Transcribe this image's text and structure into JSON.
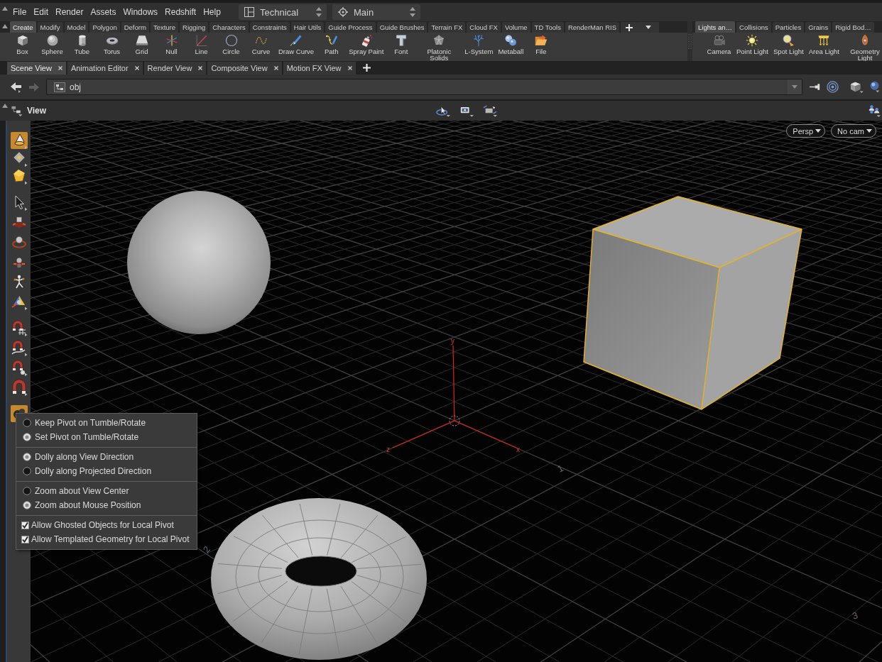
{
  "menu_bar": {
    "items": [
      "File",
      "Edit",
      "Render",
      "Assets",
      "Windows",
      "Redshift",
      "Help"
    ],
    "desktop": "Technical",
    "context": "Main"
  },
  "shelf": {
    "tabs": [
      {
        "label": "Create",
        "selected": true
      },
      {
        "label": "Modify",
        "selected": false
      },
      {
        "label": "Model",
        "selected": false
      },
      {
        "label": "Polygon",
        "selected": false
      },
      {
        "label": "Deform",
        "selected": false
      },
      {
        "label": "Texture",
        "selected": false
      },
      {
        "label": "Rigging",
        "selected": false
      },
      {
        "label": "Characters",
        "selected": false
      },
      {
        "label": "Constraints",
        "selected": false
      },
      {
        "label": "Hair Utils",
        "selected": false
      },
      {
        "label": "Guide Process",
        "selected": false
      },
      {
        "label": "Guide Brushes",
        "selected": false
      },
      {
        "label": "Terrain FX",
        "selected": false
      },
      {
        "label": "Cloud FX",
        "selected": false
      },
      {
        "label": "Volume",
        "selected": false
      },
      {
        "label": "TD Tools",
        "selected": false
      },
      {
        "label": "RenderMan RIS",
        "selected": false
      }
    ],
    "tools": [
      {
        "kind": "box",
        "label": "Box"
      },
      {
        "kind": "sphere",
        "label": "Sphere"
      },
      {
        "kind": "tube",
        "label": "Tube"
      },
      {
        "kind": "torus",
        "label": "Torus"
      },
      {
        "kind": "grid",
        "label": "Grid"
      },
      {
        "kind": "null",
        "label": "Null"
      },
      {
        "kind": "line",
        "label": "Line"
      },
      {
        "kind": "circle",
        "label": "Circle"
      },
      {
        "kind": "curve",
        "label": "Curve"
      },
      {
        "kind": "drawcurve",
        "label": "Draw Curve"
      },
      {
        "kind": "path",
        "label": "Path"
      },
      {
        "kind": "spraypaint",
        "label": "Spray Paint"
      },
      {
        "kind": "font",
        "label": "Font"
      },
      {
        "kind": "platonic",
        "label": "Platonic Solids"
      },
      {
        "kind": "lsystem",
        "label": "L-System"
      },
      {
        "kind": "metaball",
        "label": "Metaball"
      },
      {
        "kind": "file",
        "label": "File"
      }
    ]
  },
  "lights_shelf": {
    "tabs": [
      {
        "label": "Lights an…",
        "selected": true
      },
      {
        "label": "Collisions",
        "selected": false
      },
      {
        "label": "Particles",
        "selected": false
      },
      {
        "label": "Grains",
        "selected": false
      },
      {
        "label": "Rigid Bod…",
        "selected": false
      }
    ],
    "tools": [
      {
        "kind": "camera",
        "label": "Camera"
      },
      {
        "kind": "pointlight",
        "label": "Point Light"
      },
      {
        "kind": "spotlight",
        "label": "Spot Light"
      },
      {
        "kind": "arealight",
        "label": "Area Light"
      },
      {
        "kind": "geolight",
        "label": "Geometry Light"
      }
    ]
  },
  "pane_tabs": [
    {
      "label": "Scene View",
      "selected": true
    },
    {
      "label": "Animation Editor",
      "selected": false
    },
    {
      "label": "Render View",
      "selected": false
    },
    {
      "label": "Composite View",
      "selected": false
    },
    {
      "label": "Motion FX View",
      "selected": false
    }
  ],
  "path_bar": {
    "path": "obj"
  },
  "view_toolbar": {
    "title": "View"
  },
  "viewport": {
    "view_menu": "Persp",
    "camera_menu": "No cam",
    "tool_groups": [
      {
        "tools": [
          {
            "kind": "cone",
            "selected": true
          },
          {
            "kind": "diamond",
            "selected": false
          },
          {
            "kind": "cube",
            "selected": false
          }
        ]
      },
      {
        "tools": [
          {
            "kind": "pointer",
            "selected": false
          },
          {
            "kind": "move",
            "selected": false
          },
          {
            "kind": "rotate",
            "selected": false
          },
          {
            "kind": "scale",
            "selected": false
          },
          {
            "kind": "pose",
            "selected": false
          },
          {
            "kind": "gizmo",
            "selected": false
          }
        ]
      },
      {
        "tools": [
          {
            "kind": "snapgrid",
            "selected": false
          },
          {
            "kind": "snapcurve",
            "selected": false
          },
          {
            "kind": "snappoint",
            "selected": false
          },
          {
            "kind": "magnet",
            "selected": false
          }
        ]
      },
      {
        "tools": [
          {
            "kind": "orbit",
            "selected": true
          }
        ]
      }
    ],
    "objects": [
      {
        "kind": "sphere",
        "selected": false
      },
      {
        "kind": "box",
        "selected": true
      },
      {
        "kind": "torus",
        "selected": false
      }
    ],
    "axes": [
      {
        "kind": "y",
        "label": "y"
      },
      {
        "kind": "z",
        "label": "z"
      },
      {
        "kind": "x",
        "label": "x"
      }
    ],
    "grid_labels": [
      {
        "kind": "right",
        "label": "1"
      },
      {
        "kind": "left",
        "label": "2"
      },
      {
        "kind": "corner",
        "label": "3"
      }
    ]
  },
  "pivot_menu": {
    "groups": [
      {
        "items": [
          {
            "kind": "radio",
            "label": "Keep Pivot on Tumble/Rotate",
            "selected": false
          },
          {
            "kind": "radio",
            "label": "Set Pivot on Tumble/Rotate",
            "selected": true
          }
        ]
      },
      {
        "items": [
          {
            "kind": "radio",
            "label": "Dolly along View Direction",
            "selected": true
          },
          {
            "kind": "radio",
            "label": "Dolly along Projected Direction",
            "selected": false
          }
        ]
      },
      {
        "items": [
          {
            "kind": "radio",
            "label": "Zoom about View Center",
            "selected": false
          },
          {
            "kind": "radio",
            "label": "Zoom about Mouse Position",
            "selected": true
          }
        ]
      },
      {
        "items": [
          {
            "kind": "checkbox",
            "label": "Allow Ghosted Objects for Local Pivot",
            "checked": true
          },
          {
            "kind": "checkbox",
            "label": "Allow Templated Geometry for Local Pivot",
            "checked": true
          }
        ]
      }
    ]
  }
}
